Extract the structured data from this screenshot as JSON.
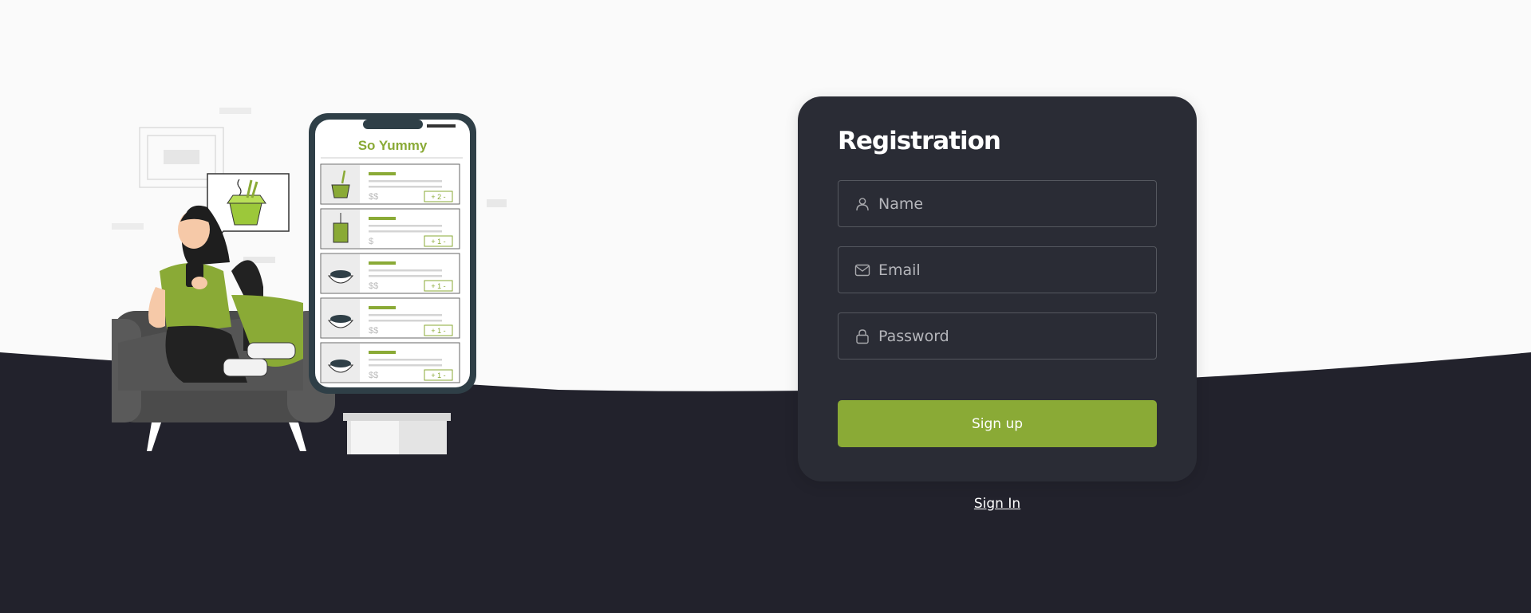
{
  "form": {
    "title": "Registration",
    "name_placeholder": "Name",
    "email_placeholder": "Email",
    "password_placeholder": "Password",
    "submit_label": "Sign up"
  },
  "signin_link": "Sign In",
  "illustration": {
    "app_title": "So Yummy",
    "menu_items": [
      {
        "price": "$$",
        "qty": "+ 2 -"
      },
      {
        "price": "$",
        "qty": "+ 1 -"
      },
      {
        "price": "$$",
        "qty": "+ 1 -"
      },
      {
        "price": "$$",
        "qty": "+ 1 -"
      },
      {
        "price": "$$",
        "qty": "+ 1 -"
      }
    ]
  },
  "icons": {
    "name": "user-icon",
    "email": "envelope-icon",
    "password": "lock-icon"
  },
  "colors": {
    "accent": "#8aaa36",
    "card_bg": "#2a2c35",
    "page_dark": "#22222c",
    "page_light": "#fafafa"
  }
}
